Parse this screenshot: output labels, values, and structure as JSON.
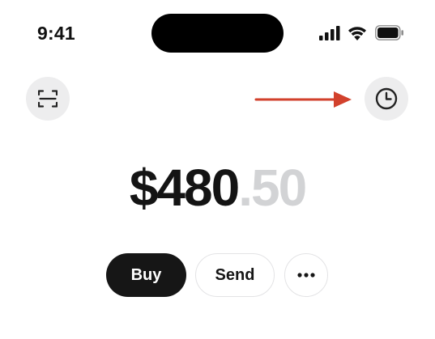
{
  "status_bar": {
    "time": "9:41",
    "icons": [
      "cellular-signal-icon",
      "wifi-icon",
      "battery-icon"
    ]
  },
  "header": {
    "left_icon": "scan-icon",
    "right_icon": "history-clock-icon",
    "annotation_icon": "red-arrow-icon",
    "annotation_color": "#d2412c"
  },
  "balance": {
    "whole": "$480",
    "cents": ".50"
  },
  "actions": {
    "buy_label": "Buy",
    "send_label": "Send",
    "more_icon": "more-dots-icon"
  },
  "colors": {
    "primary_button": "#161616",
    "cents_text": "#d2d3d5",
    "icon_button_bg": "#ededee"
  }
}
